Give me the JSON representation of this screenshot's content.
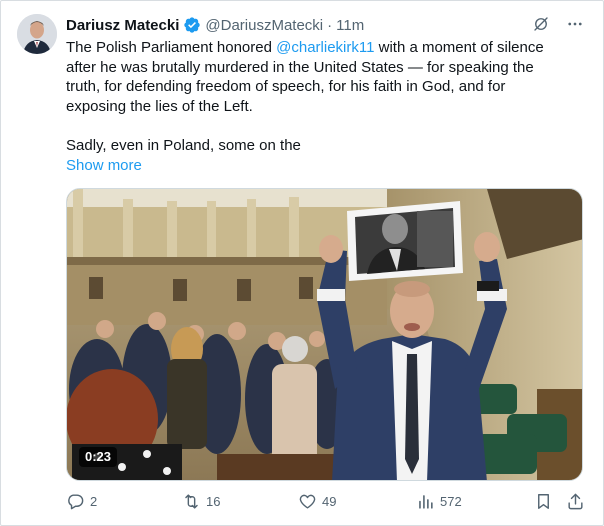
{
  "tweet": {
    "author_name": "Dariusz Matecki",
    "handle": "@DariuszMatecki",
    "separator": "·",
    "time": "11m",
    "text_line1_before": "The Polish Parliament honored ",
    "mention": "@charliekirk11",
    "text_line1_after": " with a moment of silence",
    "text_line2": "after he was brutally murdered in the United States — for speaking the",
    "text_line3": "truth, for defending freedom of speech, for his faith in God, and for",
    "text_line4": "exposing the lies of the Left.",
    "text_line5": "Sadly, even in Poland, some on the",
    "show_more": "Show more",
    "video_duration": "0:23"
  },
  "actions": {
    "replies": "2",
    "reposts": "16",
    "likes": "49",
    "views": "572"
  },
  "colors": {
    "accent": "#1d9bf0",
    "muted": "#536471",
    "text": "#0f1419"
  },
  "icons": [
    "verified-badge-icon",
    "grok-icon",
    "more-icon",
    "reply-icon",
    "repost-icon",
    "like-icon",
    "views-icon",
    "bookmark-icon",
    "share-icon"
  ]
}
